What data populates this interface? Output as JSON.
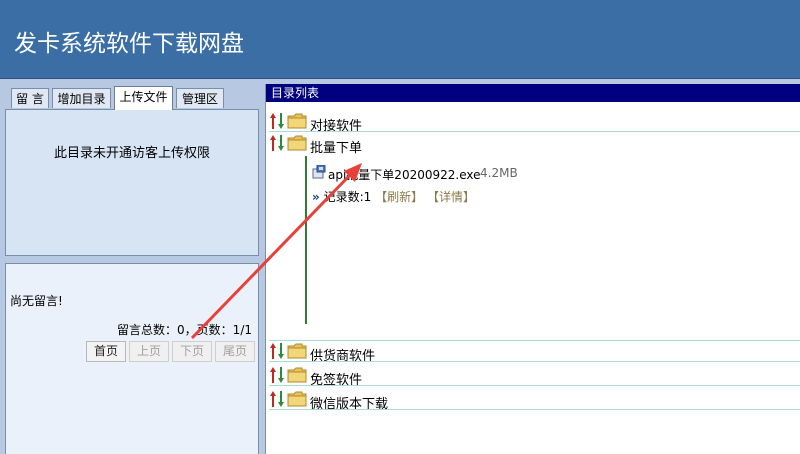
{
  "header": {
    "title": "发卡系统软件下载网盘"
  },
  "tabs": [
    {
      "label": "留 言"
    },
    {
      "label": "增加目录"
    },
    {
      "label": "上传文件"
    },
    {
      "label": "管理区"
    }
  ],
  "upload": {
    "message": "此目录未开通访客上传权限"
  },
  "comments": {
    "empty_text": "尚无留言!",
    "stats": "留言总数：0，页数：1/1",
    "pager": {
      "first": "首页",
      "prev": "上页",
      "next": "下页",
      "last": "尾页"
    }
  },
  "directory": {
    "header": "目录列表",
    "folders": [
      "对接软件",
      "批量下单",
      "供货商软件",
      "免签软件",
      "微信版本下载"
    ],
    "file": {
      "name": "api批量下单20200922.exe",
      "size": "4.2MB"
    },
    "stats": {
      "records": "记录数:1",
      "refresh": "【刷新】",
      "details": "【详情】"
    }
  },
  "colors": {
    "header_bg": "#3a6ea5",
    "dir_header_bg": "#000080",
    "annotation": "#e8403a"
  }
}
